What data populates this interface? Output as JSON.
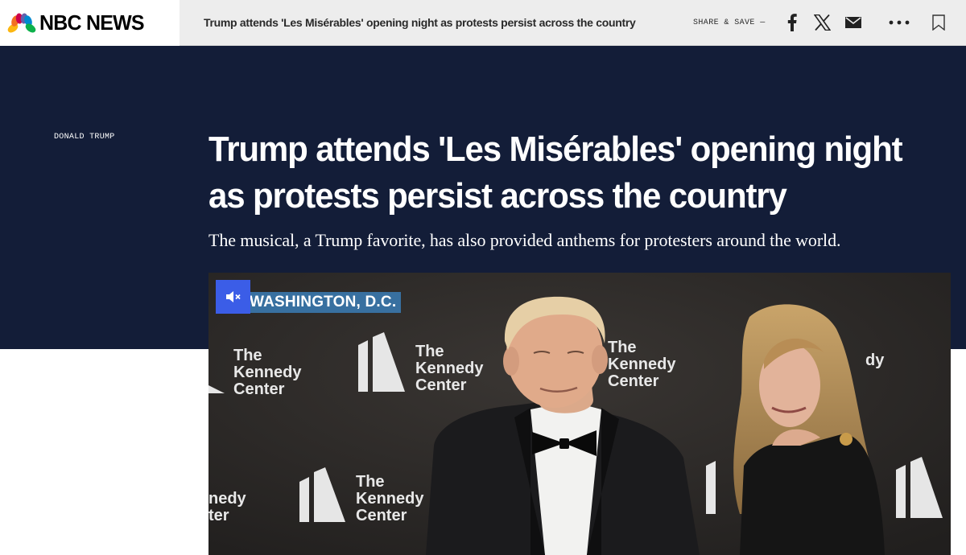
{
  "header": {
    "logo_text": "NBC NEWS",
    "headline": "Trump attends 'Les Misérables' opening night as protests persist across the country",
    "share_label": "SHARE & SAVE —",
    "icons": [
      "facebook-icon",
      "x-icon",
      "email-icon",
      "more-icon",
      "bookmark-icon"
    ]
  },
  "article": {
    "eyebrow": "DONALD TRUMP",
    "headline": "Trump attends 'Les Misérables' opening night as protests persist across the country",
    "dek": "The musical, a Trump favorite, has also provided anthems for protesters around the world."
  },
  "video": {
    "location": "WASHINGTON, D.C.",
    "mute_icon": "muted-speaker-icon",
    "backdrop_logo_line1": "The",
    "backdrop_logo_line2": "Kennedy",
    "backdrop_logo_line3": "Center"
  },
  "colors": {
    "hero_background": "#131d38",
    "mute_button": "#3b5de7",
    "location_tag": "#3976aa",
    "top_bar": "#ededed"
  }
}
